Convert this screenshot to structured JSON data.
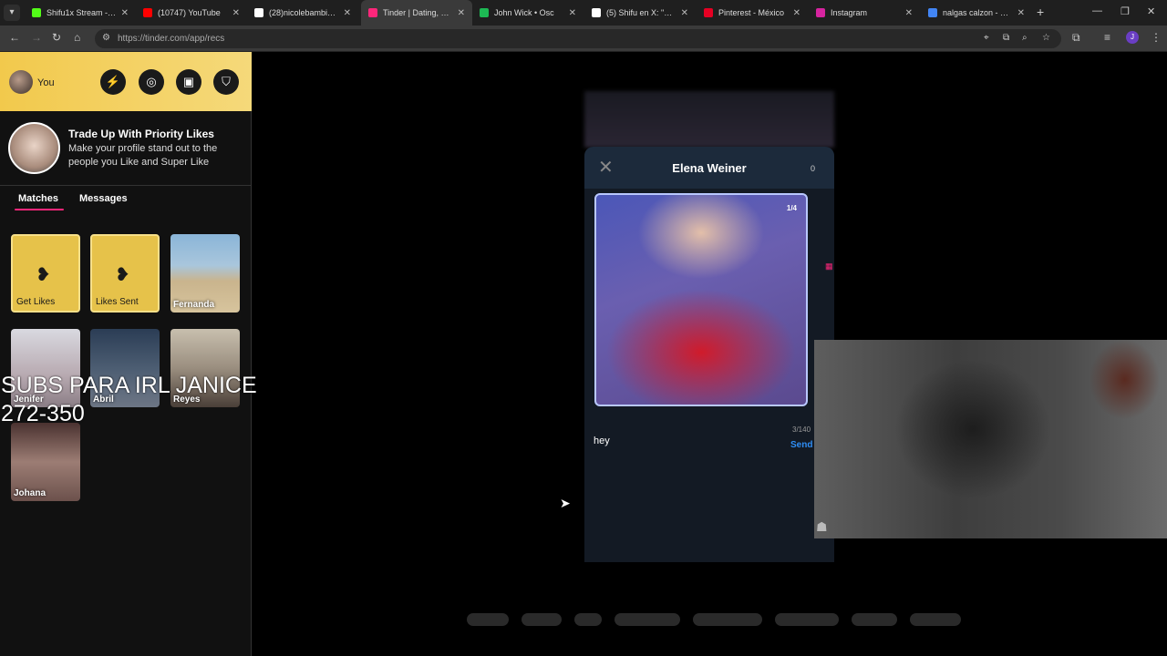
{
  "browser": {
    "tabs": [
      {
        "title": "Shifu1x Stream - We",
        "color": "#53fc18",
        "active": false
      },
      {
        "title": "(10747) YouTube",
        "color": "#ff0000",
        "active": false
      },
      {
        "title": "(28)nicolebambi_(@",
        "color": "#ffffff",
        "active": false
      },
      {
        "title": "Tinder | Dating, Make",
        "color": "#fd267a",
        "active": true
      },
      {
        "title": "John Wick • Osc",
        "color": "#1db954",
        "active": false
      },
      {
        "title": "(5) Shifu en X: \"@littl",
        "color": "#ffffff",
        "active": false
      },
      {
        "title": "Pinterest - México",
        "color": "#e60023",
        "active": false
      },
      {
        "title": "Instagram",
        "color": "#d6249f",
        "active": false
      },
      {
        "title": "nalgas calzon - Busca",
        "color": "#4285f4",
        "active": false
      }
    ],
    "url": "https://tinder.com/app/recs",
    "profile_initial": "J"
  },
  "sidebar": {
    "user_name": "You",
    "promo_title": "Trade Up With Priority Likes",
    "promo_text": "Make your profile stand out to the people you Like and Super Like",
    "tab_matches": "Matches",
    "tab_messages": "Messages",
    "cards": [
      {
        "label": "Get Likes",
        "type": "gold"
      },
      {
        "label": "Likes Sent",
        "type": "gold"
      },
      {
        "label": "Fernanda",
        "type": "photo"
      },
      {
        "label": "Jenifer",
        "type": "photo"
      },
      {
        "label": "Abril",
        "type": "photo"
      },
      {
        "label": "Reyes",
        "type": "photo"
      },
      {
        "label": "Johana",
        "type": "photo"
      }
    ]
  },
  "overlay": {
    "line1": "SUBS PARA IRL JANICE",
    "line2": "272-350"
  },
  "modal": {
    "name": "Elena Weiner",
    "count": "0",
    "pager": "1/4",
    "char_counter": "3/140",
    "message_value": "hey",
    "send_label": "Send"
  },
  "colors": {
    "tinder_pink": "#fd267a",
    "gold": "#f2c94c",
    "send_blue": "#2f8ef5"
  }
}
